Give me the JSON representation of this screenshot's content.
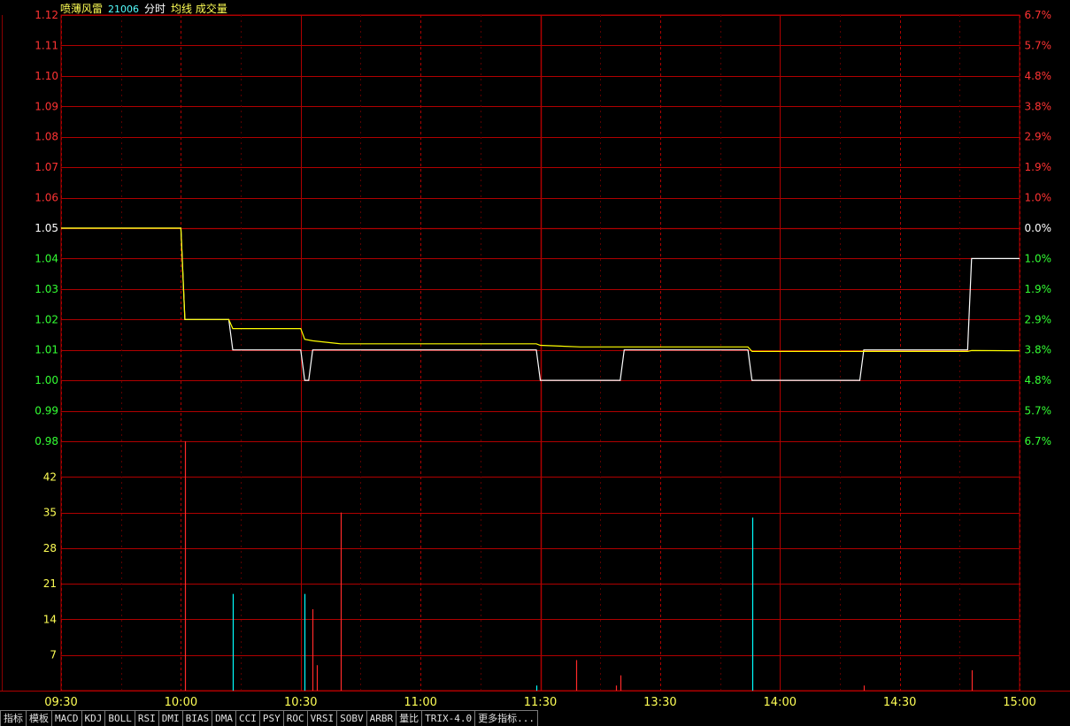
{
  "header": {
    "stock_name": "喷薄风雷",
    "code": "21006",
    "mode": "分时",
    "indicators": "均线 成交量"
  },
  "colors": {
    "up": "#ff3333",
    "down": "#33ff33",
    "neutral": "#ffffff",
    "grid": "#b00000",
    "price_line": "#ffffff",
    "avg_line": "#ffff00",
    "vol_up": "#ff2a2a",
    "vol_down": "#00ffff",
    "vol_axis_text": "#ffff55"
  },
  "price_axis": {
    "labels": [
      "1.12",
      "1.11",
      "1.10",
      "1.09",
      "1.08",
      "1.07",
      "1.06",
      "1.05",
      "1.04",
      "1.03",
      "1.02",
      "1.01",
      "1.00",
      "0.99",
      "0.98"
    ],
    "values": [
      1.12,
      1.11,
      1.1,
      1.09,
      1.08,
      1.07,
      1.06,
      1.05,
      1.04,
      1.03,
      1.02,
      1.01,
      1.0,
      0.99,
      0.98
    ],
    "pct_labels": [
      "6.7%",
      "5.7%",
      "4.8%",
      "3.8%",
      "2.9%",
      "1.9%",
      "1.0%",
      "0.0%",
      "1.0%",
      "1.9%",
      "2.9%",
      "3.8%",
      "4.8%",
      "5.7%",
      "6.7%"
    ],
    "prev_close": 1.05
  },
  "volume_axis": {
    "labels": [
      "42",
      "35",
      "28",
      "21",
      "14",
      "7"
    ],
    "values": [
      42,
      35,
      28,
      21,
      14,
      7
    ],
    "max": 49
  },
  "time_axis": {
    "labels": [
      "09:30",
      "10:00",
      "10:30",
      "11:00",
      "11:30",
      "13:30",
      "14:00",
      "14:30",
      "15:00"
    ],
    "minutes": [
      0,
      30,
      60,
      90,
      120,
      150,
      180,
      210,
      240
    ]
  },
  "chart_data": {
    "type": "line",
    "title": "喷薄风雷 21006 分时",
    "x_unit": "minutes since 09:30 (trading time)",
    "ylim": [
      0.98,
      1.12
    ],
    "series": [
      {
        "name": "分时",
        "color": "#ffffff",
        "points": [
          [
            0,
            1.05
          ],
          [
            30,
            1.05
          ],
          [
            31,
            1.02
          ],
          [
            42,
            1.02
          ],
          [
            43,
            1.01
          ],
          [
            60,
            1.01
          ],
          [
            61,
            1.0
          ],
          [
            62,
            1.0
          ],
          [
            63,
            1.01
          ],
          [
            119,
            1.01
          ],
          [
            120,
            1.0
          ],
          [
            140,
            1.0
          ],
          [
            141,
            1.01
          ],
          [
            172,
            1.01
          ],
          [
            173,
            1.0
          ],
          [
            200,
            1.0
          ],
          [
            201,
            1.01
          ],
          [
            227,
            1.01
          ],
          [
            228,
            1.04
          ],
          [
            240,
            1.04
          ]
        ]
      },
      {
        "name": "均线",
        "color": "#ffff00",
        "points": [
          [
            0,
            1.05
          ],
          [
            30,
            1.05
          ],
          [
            31,
            1.02
          ],
          [
            42,
            1.02
          ],
          [
            43,
            1.017
          ],
          [
            60,
            1.017
          ],
          [
            61,
            1.0135
          ],
          [
            63,
            1.013
          ],
          [
            70,
            1.012
          ],
          [
            119,
            1.012
          ],
          [
            120,
            1.0115
          ],
          [
            130,
            1.011
          ],
          [
            172,
            1.011
          ],
          [
            173,
            1.0095
          ],
          [
            227,
            1.0095
          ],
          [
            228,
            1.0098
          ],
          [
            240,
            1.0097
          ]
        ]
      }
    ],
    "volume": [
      {
        "t": 31,
        "v": 49,
        "dir": "up"
      },
      {
        "t": 43,
        "v": 19,
        "dir": "down"
      },
      {
        "t": 61,
        "v": 19,
        "dir": "down"
      },
      {
        "t": 63,
        "v": 16,
        "dir": "up"
      },
      {
        "t": 64,
        "v": 5,
        "dir": "up"
      },
      {
        "t": 70,
        "v": 35,
        "dir": "up"
      },
      {
        "t": 119,
        "v": 1,
        "dir": "down"
      },
      {
        "t": 129,
        "v": 6,
        "dir": "up"
      },
      {
        "t": 139,
        "v": 1,
        "dir": "up"
      },
      {
        "t": 140,
        "v": 3,
        "dir": "up"
      },
      {
        "t": 173,
        "v": 34,
        "dir": "down"
      },
      {
        "t": 201,
        "v": 1,
        "dir": "up"
      },
      {
        "t": 228,
        "v": 4,
        "dir": "up"
      }
    ]
  },
  "tabs": [
    "指标",
    "模板",
    "MACD",
    "KDJ",
    "BOLL",
    "RSI",
    "DMI",
    "BIAS",
    "DMA",
    "CCI",
    "PSY",
    "ROC",
    "VRSI",
    "SOBV",
    "ARBR",
    "量比",
    "TRIX-4.0",
    "更多指标..."
  ]
}
